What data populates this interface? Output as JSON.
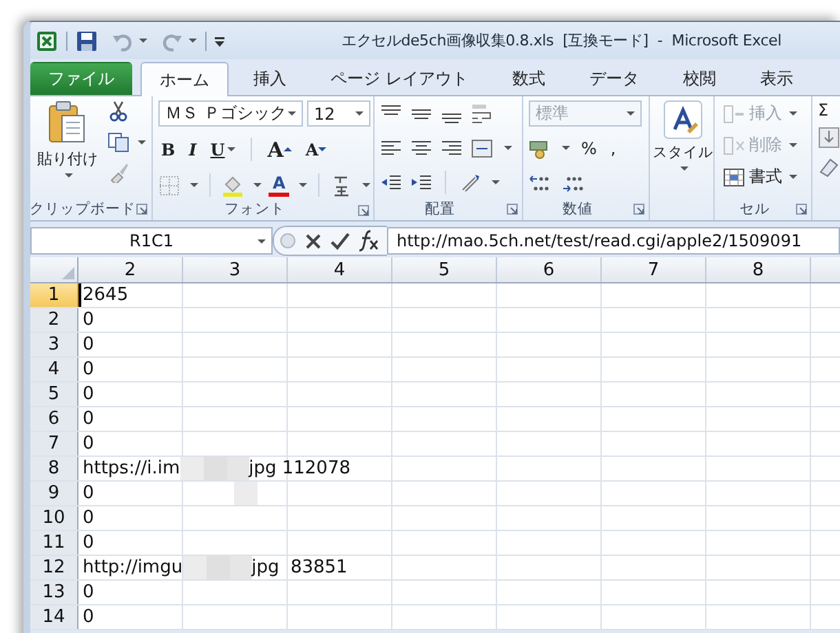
{
  "window": {
    "title": "エクセルde5ch画像収集0.8.xls  [互換モード]  -  Microsoft Excel"
  },
  "tabs": [
    {
      "label": "ファイル",
      "kind": "file",
      "selected": false
    },
    {
      "label": "ホーム",
      "kind": "tab",
      "selected": true
    },
    {
      "label": "挿入",
      "kind": "tab",
      "selected": false
    },
    {
      "label": "ページ レイアウト",
      "kind": "tab",
      "selected": false
    },
    {
      "label": "数式",
      "kind": "tab",
      "selected": false
    },
    {
      "label": "データ",
      "kind": "tab",
      "selected": false
    },
    {
      "label": "校閲",
      "kind": "tab",
      "selected": false
    },
    {
      "label": "表示",
      "kind": "tab",
      "selected": false
    }
  ],
  "ribbon": {
    "clipboard": {
      "label": "クリップボード",
      "paste": "貼り付け"
    },
    "font": {
      "label": "フォント",
      "name": "ＭＳ Ｐゴシック",
      "size": "12",
      "bold": "B",
      "italic": "I",
      "underline": "U",
      "grow": "A",
      "shrink": "A",
      "font_color_letter": "A"
    },
    "alignment": {
      "label": "配置"
    },
    "number": {
      "label": "数値",
      "format": {
        "value": "標準",
        "disabled": true
      },
      "percent": "%",
      "comma": ","
    },
    "styles": {
      "button": "スタイル"
    },
    "cells": {
      "label": "セル",
      "buttons": [
        {
          "label": "挿入",
          "kind": "insert",
          "disabled": true
        },
        {
          "label": "削除",
          "kind": "delete",
          "disabled": true
        },
        {
          "label": "書式",
          "kind": "format",
          "disabled": false
        }
      ]
    },
    "editing": {
      "sum": "Σ"
    }
  },
  "formula_bar": {
    "name_box": "R1C1",
    "formula": "http://mao.5ch.net/test/read.cgi/apple2/1509091"
  },
  "sheet": {
    "columns": [
      "2",
      "3",
      "4",
      "5",
      "6",
      "7",
      "8"
    ],
    "rows": [
      {
        "header": "1",
        "selected": true,
        "value": "2645"
      },
      {
        "header": "2",
        "selected": false,
        "value": "0"
      },
      {
        "header": "3",
        "selected": false,
        "value": "0"
      },
      {
        "header": "4",
        "selected": false,
        "value": "0"
      },
      {
        "header": "5",
        "selected": false,
        "value": "0"
      },
      {
        "header": "6",
        "selected": false,
        "value": "0"
      },
      {
        "header": "7",
        "selected": false,
        "value": "0"
      },
      {
        "header": "8",
        "selected": false,
        "value": "https://i.im",
        "blurred": true,
        "value_end": "jpg 112078"
      },
      {
        "header": "9",
        "selected": false,
        "value": "0",
        "blurred": true
      },
      {
        "header": "10",
        "selected": false,
        "value": "0"
      },
      {
        "header": "11",
        "selected": false,
        "value": "0"
      },
      {
        "header": "12",
        "selected": false,
        "value": "http://imgu",
        "blurred": true,
        "value_end": "jpg  83851"
      },
      {
        "header": "13",
        "selected": false,
        "value": "0"
      },
      {
        "header": "14",
        "selected": false,
        "value": "0"
      }
    ]
  }
}
